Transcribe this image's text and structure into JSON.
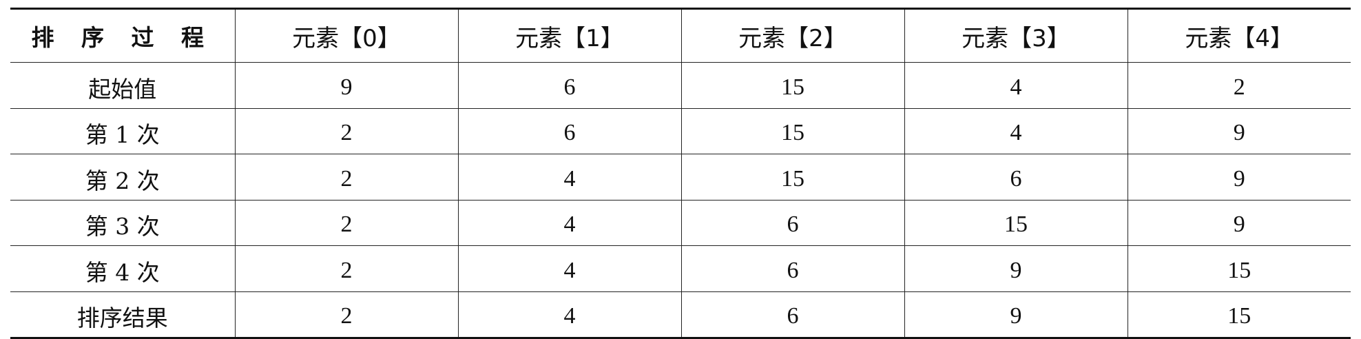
{
  "table": {
    "headers": [
      "排 序 过 程",
      "元素【0】",
      "元素【1】",
      "元素【2】",
      "元素【3】",
      "元素【4】"
    ],
    "rows": [
      {
        "label": "起始值",
        "cells": [
          "9",
          "6",
          "15",
          "4",
          "2"
        ]
      },
      {
        "label": "第 1 次",
        "cells": [
          "2",
          "6",
          "15",
          "4",
          "9"
        ]
      },
      {
        "label": "第 2 次",
        "cells": [
          "2",
          "4",
          "15",
          "6",
          "9"
        ]
      },
      {
        "label": "第 3 次",
        "cells": [
          "2",
          "4",
          "6",
          "15",
          "9"
        ]
      },
      {
        "label": "第 4 次",
        "cells": [
          "2",
          "4",
          "6",
          "9",
          "15"
        ]
      },
      {
        "label": "排序结果",
        "cells": [
          "2",
          "4",
          "6",
          "9",
          "15"
        ]
      }
    ]
  }
}
